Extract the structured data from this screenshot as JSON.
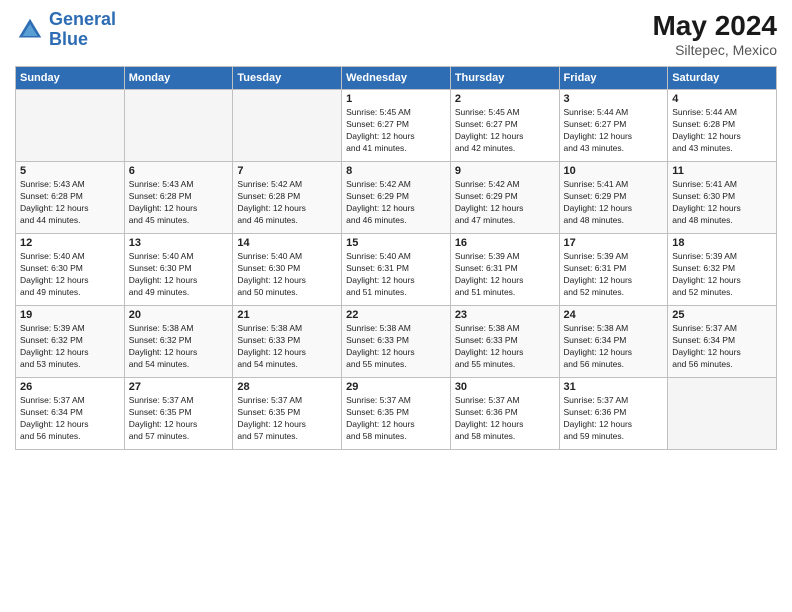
{
  "header": {
    "logo_line1": "General",
    "logo_line2": "Blue",
    "month": "May 2024",
    "location": "Siltepec, Mexico"
  },
  "weekdays": [
    "Sunday",
    "Monday",
    "Tuesday",
    "Wednesday",
    "Thursday",
    "Friday",
    "Saturday"
  ],
  "weeks": [
    [
      {
        "day": "",
        "info": "",
        "empty": true
      },
      {
        "day": "",
        "info": "",
        "empty": true
      },
      {
        "day": "",
        "info": "",
        "empty": true
      },
      {
        "day": "1",
        "info": "Sunrise: 5:45 AM\nSunset: 6:27 PM\nDaylight: 12 hours\nand 41 minutes."
      },
      {
        "day": "2",
        "info": "Sunrise: 5:45 AM\nSunset: 6:27 PM\nDaylight: 12 hours\nand 42 minutes."
      },
      {
        "day": "3",
        "info": "Sunrise: 5:44 AM\nSunset: 6:27 PM\nDaylight: 12 hours\nand 43 minutes."
      },
      {
        "day": "4",
        "info": "Sunrise: 5:44 AM\nSunset: 6:28 PM\nDaylight: 12 hours\nand 43 minutes."
      }
    ],
    [
      {
        "day": "5",
        "info": "Sunrise: 5:43 AM\nSunset: 6:28 PM\nDaylight: 12 hours\nand 44 minutes."
      },
      {
        "day": "6",
        "info": "Sunrise: 5:43 AM\nSunset: 6:28 PM\nDaylight: 12 hours\nand 45 minutes."
      },
      {
        "day": "7",
        "info": "Sunrise: 5:42 AM\nSunset: 6:28 PM\nDaylight: 12 hours\nand 46 minutes."
      },
      {
        "day": "8",
        "info": "Sunrise: 5:42 AM\nSunset: 6:29 PM\nDaylight: 12 hours\nand 46 minutes."
      },
      {
        "day": "9",
        "info": "Sunrise: 5:42 AM\nSunset: 6:29 PM\nDaylight: 12 hours\nand 47 minutes."
      },
      {
        "day": "10",
        "info": "Sunrise: 5:41 AM\nSunset: 6:29 PM\nDaylight: 12 hours\nand 48 minutes."
      },
      {
        "day": "11",
        "info": "Sunrise: 5:41 AM\nSunset: 6:30 PM\nDaylight: 12 hours\nand 48 minutes."
      }
    ],
    [
      {
        "day": "12",
        "info": "Sunrise: 5:40 AM\nSunset: 6:30 PM\nDaylight: 12 hours\nand 49 minutes."
      },
      {
        "day": "13",
        "info": "Sunrise: 5:40 AM\nSunset: 6:30 PM\nDaylight: 12 hours\nand 49 minutes."
      },
      {
        "day": "14",
        "info": "Sunrise: 5:40 AM\nSunset: 6:30 PM\nDaylight: 12 hours\nand 50 minutes."
      },
      {
        "day": "15",
        "info": "Sunrise: 5:40 AM\nSunset: 6:31 PM\nDaylight: 12 hours\nand 51 minutes."
      },
      {
        "day": "16",
        "info": "Sunrise: 5:39 AM\nSunset: 6:31 PM\nDaylight: 12 hours\nand 51 minutes."
      },
      {
        "day": "17",
        "info": "Sunrise: 5:39 AM\nSunset: 6:31 PM\nDaylight: 12 hours\nand 52 minutes."
      },
      {
        "day": "18",
        "info": "Sunrise: 5:39 AM\nSunset: 6:32 PM\nDaylight: 12 hours\nand 52 minutes."
      }
    ],
    [
      {
        "day": "19",
        "info": "Sunrise: 5:39 AM\nSunset: 6:32 PM\nDaylight: 12 hours\nand 53 minutes."
      },
      {
        "day": "20",
        "info": "Sunrise: 5:38 AM\nSunset: 6:32 PM\nDaylight: 12 hours\nand 54 minutes."
      },
      {
        "day": "21",
        "info": "Sunrise: 5:38 AM\nSunset: 6:33 PM\nDaylight: 12 hours\nand 54 minutes."
      },
      {
        "day": "22",
        "info": "Sunrise: 5:38 AM\nSunset: 6:33 PM\nDaylight: 12 hours\nand 55 minutes."
      },
      {
        "day": "23",
        "info": "Sunrise: 5:38 AM\nSunset: 6:33 PM\nDaylight: 12 hours\nand 55 minutes."
      },
      {
        "day": "24",
        "info": "Sunrise: 5:38 AM\nSunset: 6:34 PM\nDaylight: 12 hours\nand 56 minutes."
      },
      {
        "day": "25",
        "info": "Sunrise: 5:37 AM\nSunset: 6:34 PM\nDaylight: 12 hours\nand 56 minutes."
      }
    ],
    [
      {
        "day": "26",
        "info": "Sunrise: 5:37 AM\nSunset: 6:34 PM\nDaylight: 12 hours\nand 56 minutes."
      },
      {
        "day": "27",
        "info": "Sunrise: 5:37 AM\nSunset: 6:35 PM\nDaylight: 12 hours\nand 57 minutes."
      },
      {
        "day": "28",
        "info": "Sunrise: 5:37 AM\nSunset: 6:35 PM\nDaylight: 12 hours\nand 57 minutes."
      },
      {
        "day": "29",
        "info": "Sunrise: 5:37 AM\nSunset: 6:35 PM\nDaylight: 12 hours\nand 58 minutes."
      },
      {
        "day": "30",
        "info": "Sunrise: 5:37 AM\nSunset: 6:36 PM\nDaylight: 12 hours\nand 58 minutes."
      },
      {
        "day": "31",
        "info": "Sunrise: 5:37 AM\nSunset: 6:36 PM\nDaylight: 12 hours\nand 59 minutes."
      },
      {
        "day": "",
        "info": "",
        "empty": true
      }
    ]
  ]
}
